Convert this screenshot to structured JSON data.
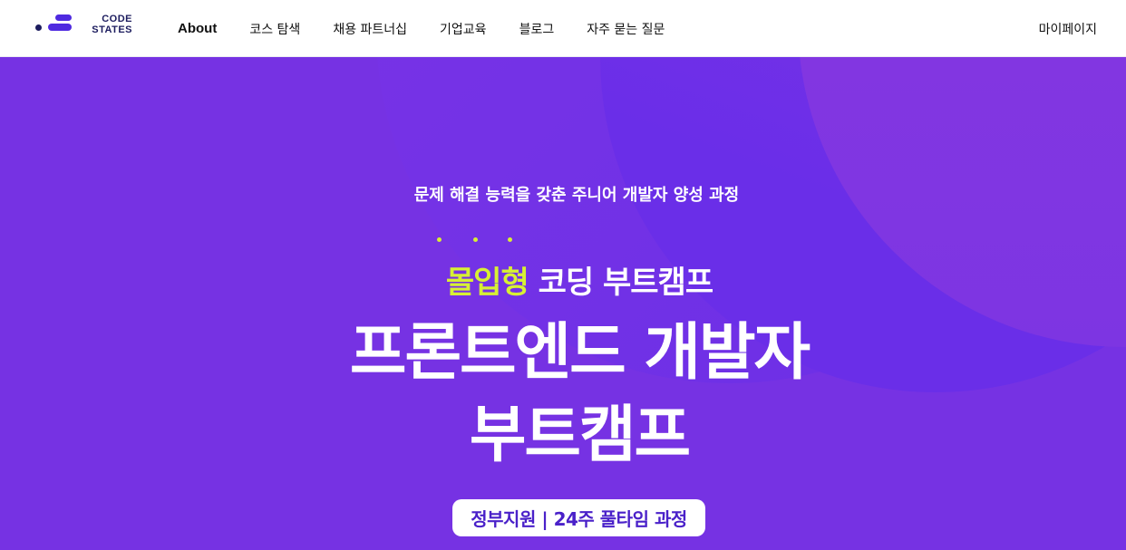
{
  "brand": {
    "logo_lines": [
      "CODE",
      "STATES"
    ],
    "brand_color": "#4f2ae0",
    "dark_color": "#1c1c5e"
  },
  "nav": {
    "items": [
      {
        "label": "About"
      },
      {
        "label": "코스 탐색"
      },
      {
        "label": "채용 파트너십"
      },
      {
        "label": "기업교육"
      },
      {
        "label": "블로그"
      },
      {
        "label": "자주 묻는 질문"
      }
    ],
    "mypage": "마이페이지"
  },
  "hero": {
    "background_color": "#7632e3",
    "accent_color": "#d7f034",
    "subtitle": "문제 해결 능력을 갖춘 주니어 개발자 양성 과정",
    "tagline_highlight": "몰입형",
    "tagline_rest": "코딩 부트캠프",
    "title_line1": "프론트엔드 개발자",
    "title_line2": "부트캠프",
    "badge": "정부지원 | 24주 풀타임 과정"
  }
}
